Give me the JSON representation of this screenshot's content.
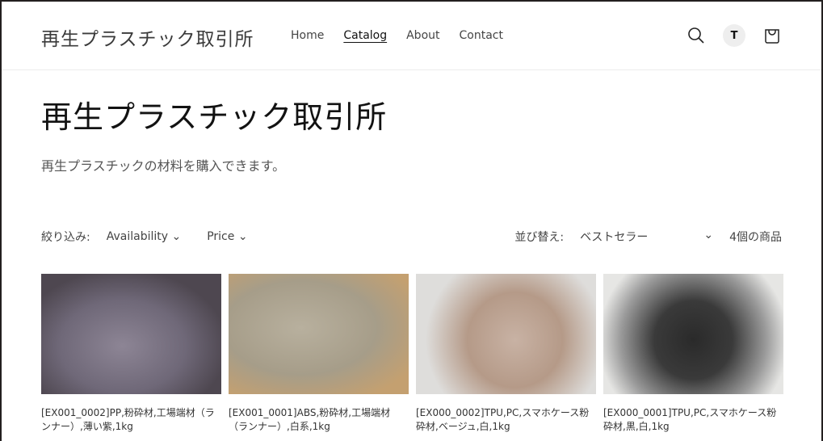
{
  "header": {
    "logo": "再生プラスチック取引所",
    "nav": [
      "Home",
      "Catalog",
      "About",
      "Contact"
    ],
    "active_nav": "Catalog",
    "avatar_initial": "T"
  },
  "page": {
    "title": "再生プラスチック取引所",
    "description": "再生プラスチックの材料を購入できます。"
  },
  "filters": {
    "label": "絞り込み:",
    "availability": "Availability",
    "price": "Price",
    "sort_label": "並び替え:",
    "sort_value": "ベストセラー",
    "count": "4個の商品"
  },
  "products": [
    {
      "title": "[EX001_0002]PP,粉砕材,工場端材（ランナー）,薄い紫,1kg"
    },
    {
      "title": "[EX001_0001]ABS,粉砕材,工場端材（ランナー）,白系,1kg"
    },
    {
      "title": "[EX000_0002]TPU,PC,スマホケース粉砕材,ベージュ,白,1kg"
    },
    {
      "title": "[EX000_0001]TPU,PC,スマホケース粉砕材,黒,白,1kg"
    }
  ]
}
